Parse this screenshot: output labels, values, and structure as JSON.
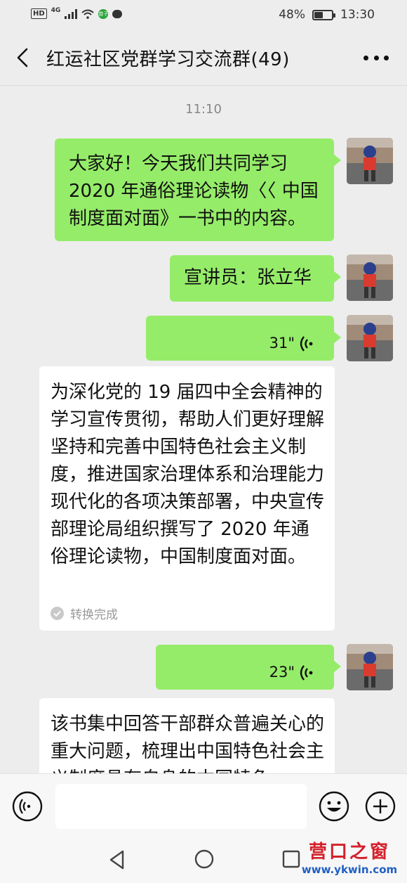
{
  "status_bar": {
    "network_hd": "HD",
    "network_gen": "4G",
    "app_badge": "苗子",
    "battery": "48%",
    "time": "13:30"
  },
  "nav": {
    "title": "红运社区党群学习交流群(49)"
  },
  "chat": {
    "timestamp": "11:10",
    "messages": [
      {
        "type": "text",
        "text": "大家好！今天我们共同学习2020 年通俗理论读物〈〈 中国制度面对面》一书中的内容。"
      },
      {
        "type": "text",
        "text": "宣讲员：张立华"
      },
      {
        "type": "voice",
        "duration": "31\""
      },
      {
        "type": "transcript",
        "text": "为深化党的 19 届四中全会精神的学习宣传贯彻，帮助人们更好理解坚持和完善中国特色社会主义制度，推进国家治理体系和治理能力现代化的各项决策部署，中央宣传部理论局组织撰写了 2020 年通俗理论读物，中国制度面对面。",
        "status": "转换完成"
      },
      {
        "type": "voice",
        "duration": "23\""
      },
      {
        "type": "transcript",
        "text": "该书集中回答干部群众普遍关心的重大问题，梳理出中国特色社会主义制度具有自身的本国特色"
      }
    ]
  },
  "watermark": {
    "name": "营口之窗",
    "url": "www.ykwin.com"
  },
  "colors": {
    "outgoing_bubble": "#95ec69",
    "incoming_bubble": "#ffffff",
    "background": "#ededed"
  },
  "icons": [
    "back-arrow-icon",
    "more-icon",
    "voice-wave-icon",
    "check-circle-icon",
    "voice-input-icon",
    "emoji-icon",
    "plus-icon",
    "nav-back-icon",
    "nav-home-icon",
    "nav-recent-icon"
  ]
}
